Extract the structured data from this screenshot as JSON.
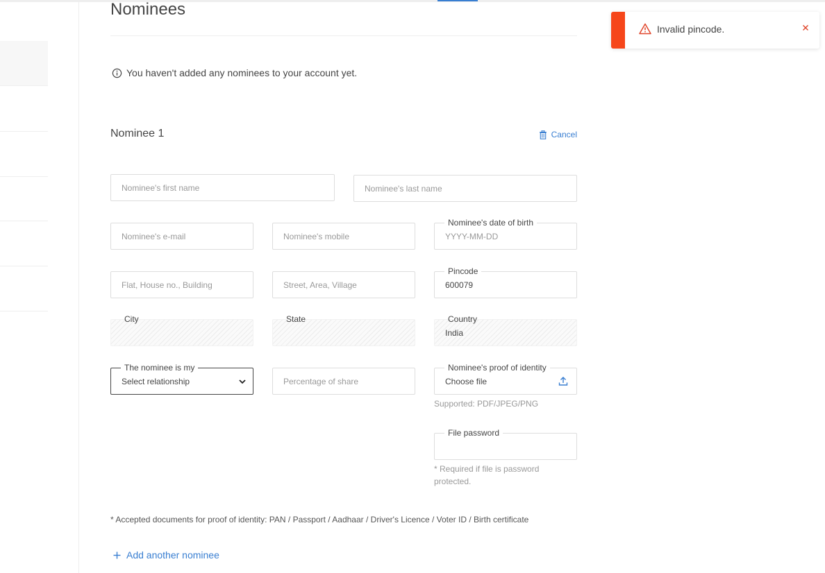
{
  "page": {
    "title": "Nominees",
    "info": "You haven't added any nominees to your account yet."
  },
  "nominee": {
    "heading": "Nominee 1",
    "cancel_label": "Cancel"
  },
  "fields": {
    "first_name": {
      "placeholder": "Nominee's first name"
    },
    "last_name": {
      "placeholder": "Nominee's last name"
    },
    "email": {
      "placeholder": "Nominee's e-mail"
    },
    "mobile": {
      "placeholder": "Nominee's mobile"
    },
    "dob": {
      "label": "Nominee's date of birth",
      "placeholder": "YYYY-MM-DD"
    },
    "address1": {
      "placeholder": "Flat, House no., Building"
    },
    "address2": {
      "placeholder": "Street, Area, Village"
    },
    "pincode": {
      "label": "Pincode",
      "value": "600079"
    },
    "city": {
      "label": "City",
      "value": ""
    },
    "state": {
      "label": "State",
      "value": ""
    },
    "country": {
      "label": "Country",
      "value": "India"
    },
    "relationship": {
      "label": "The nominee is my",
      "value": "Select relationship"
    },
    "share": {
      "placeholder": "Percentage of share"
    },
    "proof": {
      "label": "Nominee's proof of identity",
      "value": "Choose file",
      "hint": "Supported: PDF/JPEG/PNG"
    },
    "file_password": {
      "label": "File password",
      "hint_line1": "* Required if file is password",
      "hint_line2": "protected."
    }
  },
  "footnote": "* Accepted documents for proof of identity: PAN / Passport / Aadhaar / Driver's Licence / Voter ID / Birth certificate",
  "add_another": "Add another nominee",
  "toast": {
    "message": "Invalid pincode.",
    "type": "error",
    "color": "#f6461a"
  },
  "colors": {
    "accent": "#387ed1",
    "error": "#f6461a",
    "text": "#444444"
  },
  "icons": {
    "info": "info-circle-icon",
    "cancel": "trash-icon",
    "select": "chevron-down-icon",
    "upload": "upload-icon",
    "add": "plus-icon",
    "toast": "warning-triangle-icon",
    "close": "close-icon"
  }
}
